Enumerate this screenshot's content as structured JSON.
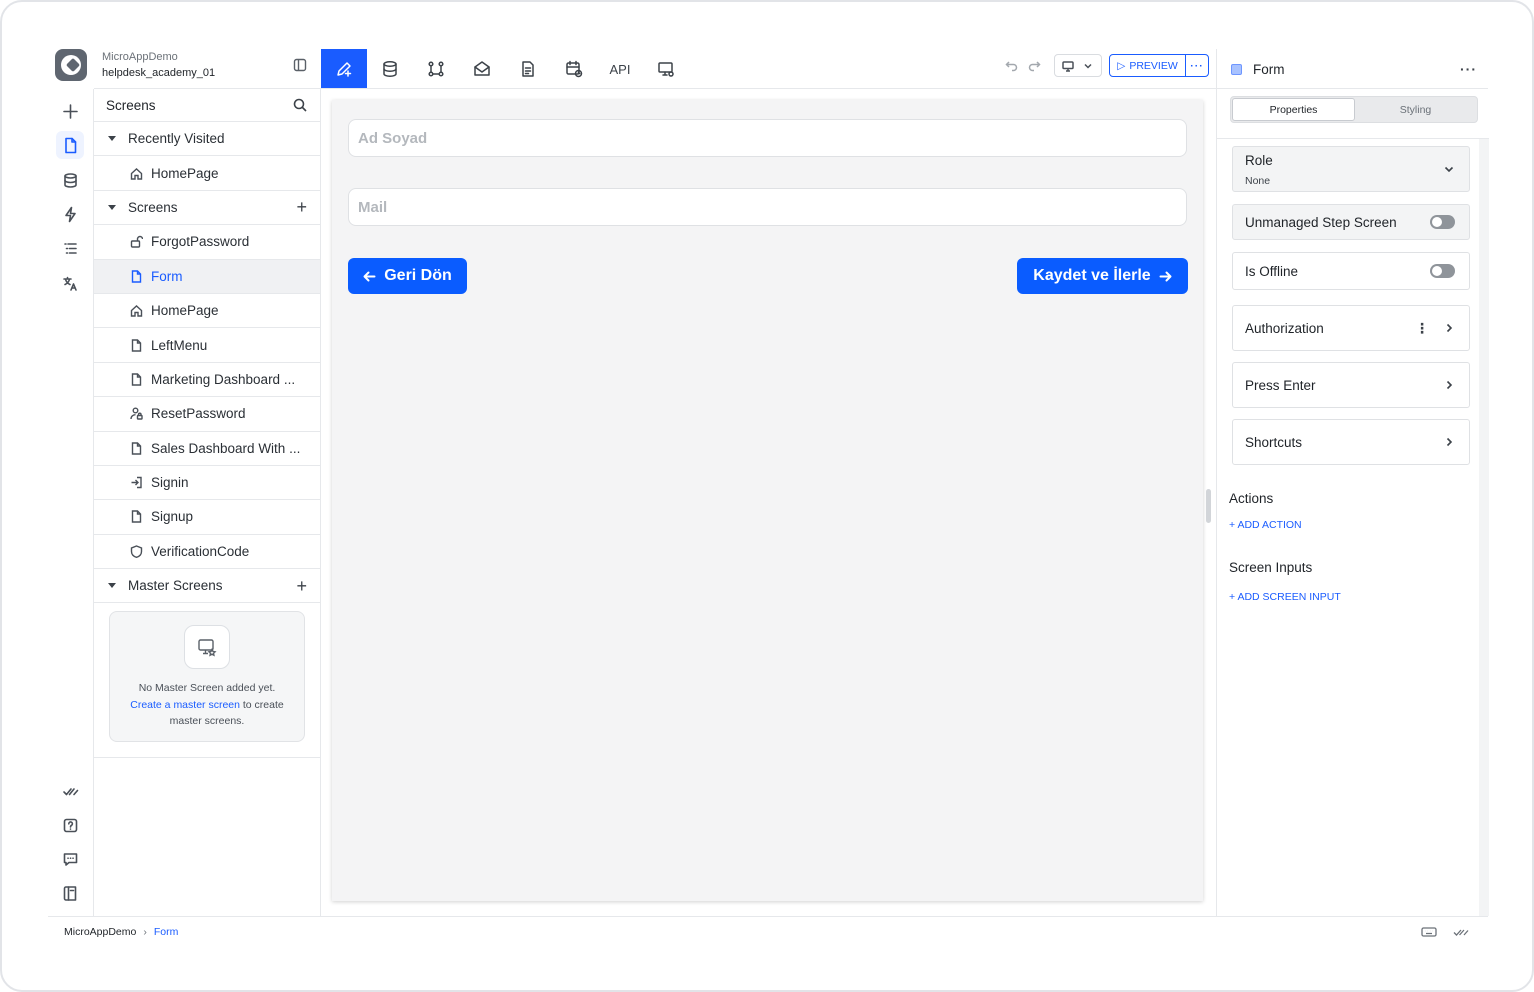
{
  "app": {
    "name": "MicroAppDemo",
    "project": "helpdesk_academy_01"
  },
  "toolbar": {
    "tabs": [
      {
        "icon": "pen-plus-icon",
        "active": true
      },
      {
        "icon": "database-icon"
      },
      {
        "icon": "workflow-icon"
      },
      {
        "icon": "mail-icon"
      },
      {
        "icon": "document-icon"
      },
      {
        "icon": "calendar-clock-icon"
      },
      {
        "label": "API"
      },
      {
        "icon": "monitor-settings-icon"
      }
    ],
    "preview_label": "PREVIEW",
    "more_label": "···"
  },
  "screens_panel": {
    "title": "Screens",
    "recently_visited": {
      "label": "Recently Visited",
      "items": [
        "HomePage"
      ]
    },
    "screens": {
      "label": "Screens",
      "items": [
        {
          "label": "ForgotPassword",
          "icon": "lock-open-icon"
        },
        {
          "label": "Form",
          "icon": "file-icon",
          "selected": true
        },
        {
          "label": "HomePage",
          "icon": "home-icon"
        },
        {
          "label": "LeftMenu",
          "icon": "file-icon"
        },
        {
          "label": "Marketing Dashboard ...",
          "icon": "file-icon"
        },
        {
          "label": "ResetPassword",
          "icon": "user-lock-icon"
        },
        {
          "label": "Sales Dashboard With ...",
          "icon": "file-icon"
        },
        {
          "label": "Signin",
          "icon": "sign-in-icon"
        },
        {
          "label": "Signup",
          "icon": "file-icon"
        },
        {
          "label": "VerificationCode",
          "icon": "shield-icon"
        }
      ]
    },
    "master_screens": {
      "label": "Master Screens",
      "empty_line1": "No Master Screen added yet.",
      "empty_link": "Create a master screen",
      "empty_line2_rest": " to create",
      "empty_line3": "master screens."
    }
  },
  "canvas": {
    "name_placeholder": "Ad Soyad",
    "mail_placeholder": "Mail",
    "back_button": "Geri Dön",
    "save_button": "Kaydet ve İlerle"
  },
  "properties": {
    "title": "Form",
    "tabs": [
      "Properties",
      "Styling"
    ],
    "active_tab": "Properties",
    "role_label": "Role",
    "role_value": "None",
    "unmanaged_label": "Unmanaged Step Screen",
    "offline_label": "Is Offline",
    "authorization_label": "Authorization",
    "press_enter_label": "Press Enter",
    "shortcuts_label": "Shortcuts",
    "actions_title": "Actions",
    "add_action": "+ ADD ACTION",
    "screen_inputs_title": "Screen Inputs",
    "add_screen_input": "+ ADD SCREEN INPUT"
  },
  "footer": {
    "breadcrumb": [
      "MicroAppDemo",
      "Form"
    ]
  },
  "colors": {
    "accent": "#1a5cff",
    "button": "#0a5cff"
  }
}
